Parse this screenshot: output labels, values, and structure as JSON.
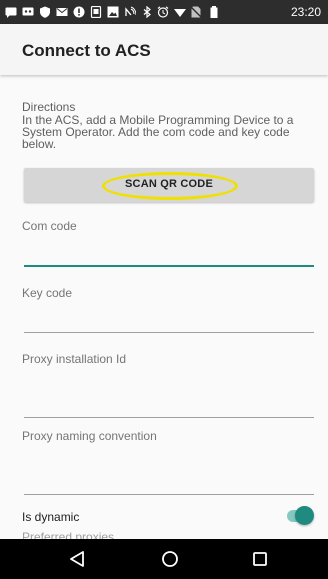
{
  "status_bar": {
    "time": "23:20",
    "icons": [
      "message-icon",
      "voicemail-icon",
      "shield-icon",
      "mail-icon",
      "alert-icon",
      "screenshot-icon",
      "image-icon",
      "nfc-icon",
      "bluetooth-icon",
      "alarm-icon",
      "wifi-icon",
      "no-sim-icon",
      "battery-icon"
    ]
  },
  "app_bar": {
    "title": "Connect to ACS"
  },
  "form": {
    "directions_label": "Directions",
    "directions_text": "In the ACS, add a Mobile Programming Device to a System Operator. Add the com code and key code below.",
    "scan_button": "SCAN QR CODE",
    "com_code_label": "Com code",
    "com_code_value": "",
    "key_code_label": "Key code",
    "key_code_value": "",
    "proxy_id_label": "Proxy installation Id",
    "proxy_naming_label": "Proxy naming convention",
    "is_dynamic_label": "Is dynamic",
    "is_dynamic_on": true,
    "preferred_proxies_label": "Preferred proxies"
  },
  "colors": {
    "accent": "#1f8b80",
    "highlight": "#f0e000",
    "status_bar": "#2d2d2d",
    "nav_bar": "#000000"
  },
  "nav_bar": {
    "buttons": [
      "back-icon",
      "home-icon",
      "recents-icon"
    ]
  }
}
